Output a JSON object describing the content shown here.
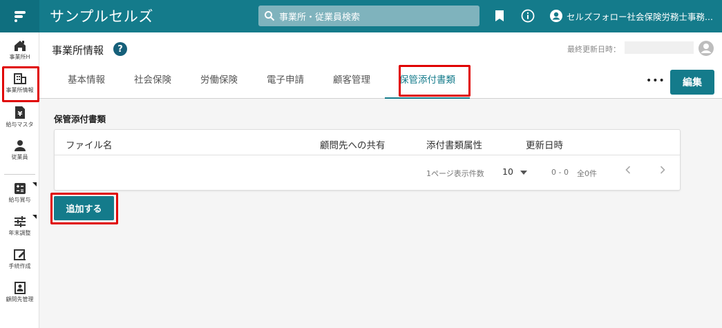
{
  "header": {
    "app_title": "サンプルセルズ",
    "search_placeholder": "事業所・従業員検索",
    "user_name": "セルズフォロー社会保険労務士事務..."
  },
  "sidebar": {
    "items": [
      {
        "label": "事業所H",
        "icon": "office-home-icon"
      },
      {
        "label": "事業所情報",
        "icon": "building-icon"
      },
      {
        "label": "給与マスタ",
        "icon": "yen-document-icon"
      },
      {
        "label": "従業員",
        "icon": "person-icon"
      },
      {
        "label": "給与賞与",
        "icon": "calculator-icon"
      },
      {
        "label": "年末調整",
        "icon": "sliders-icon"
      },
      {
        "label": "手続作成",
        "icon": "edit-form-icon"
      },
      {
        "label": "顧問先管理",
        "icon": "contact-card-icon"
      }
    ]
  },
  "page": {
    "title": "事業所情報",
    "last_updated_label": "最終更新日時："
  },
  "tabs": [
    "基本情報",
    "社会保険",
    "労働保険",
    "電子申請",
    "顧客管理",
    "保管添付書類"
  ],
  "active_tab": "保管添付書類",
  "edit_label": "編集",
  "more_label": "•••",
  "section": {
    "title": "保管添付書類",
    "columns": [
      "ファイル名",
      "顧問先への共有",
      "添付書類属性",
      "更新日時"
    ],
    "rows": [],
    "pagination": {
      "per_page_label": "1ページ表示件数",
      "per_page_value": "10",
      "range": "0 - 0",
      "total": "全0件"
    }
  },
  "add_button_label": "追加する",
  "colors": {
    "accent": "#147b8b",
    "highlight": "#e00000"
  }
}
